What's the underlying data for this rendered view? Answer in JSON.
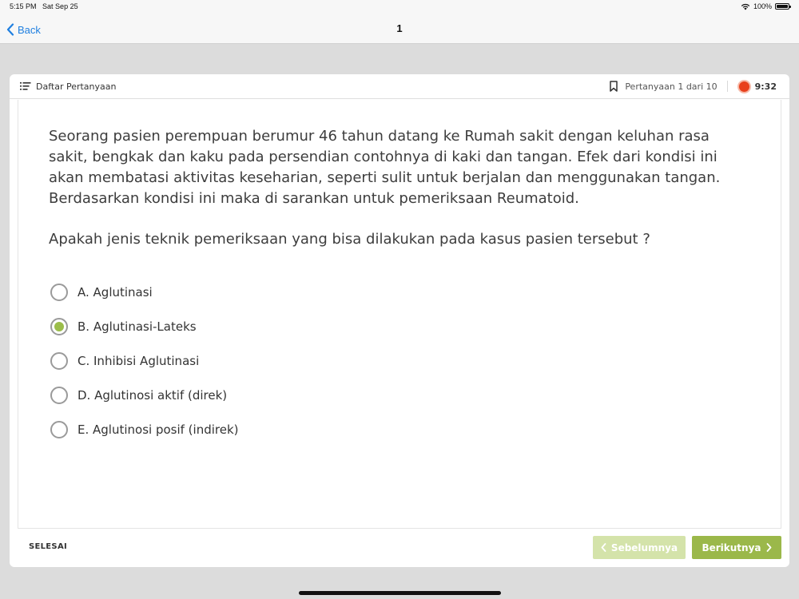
{
  "status_bar": {
    "time": "5:15 PM",
    "date": "Sat Sep 25",
    "battery": "100%"
  },
  "nav": {
    "back_label": "Back",
    "title": "1"
  },
  "header": {
    "list_label": "Daftar Pertanyaan",
    "question_counter": "Pertanyaan 1 dari 10",
    "timer": "9:32"
  },
  "question": {
    "text": "Seorang pasien perempuan berumur 46 tahun datang ke Rumah sakit dengan keluhan rasa sakit, bengkak dan kaku pada persendian contohnya di kaki dan tangan. Efek dari kondisi ini akan membatasi aktivitas keseharian, seperti sulit untuk berjalan dan menggunakan tangan. Berdasarkan kondisi ini maka di sarankan untuk pemeriksaan Reumatoid.",
    "prompt": "Apakah jenis teknik pemeriksaan yang bisa dilakukan pada kasus pasien tersebut ?",
    "options": [
      {
        "label": "A. Aglutinasi",
        "selected": false
      },
      {
        "label": "B. Aglutinasi-Lateks",
        "selected": true
      },
      {
        "label": "C. Inhibisi Aglutinasi",
        "selected": false
      },
      {
        "label": "D. Aglutinosi aktif (direk)",
        "selected": false
      },
      {
        "label": "E. Aglutinosi posif (indirek)",
        "selected": false
      }
    ]
  },
  "footer": {
    "finish_label": "SELESAI",
    "prev_label": "Sebelumnya",
    "next_label": "Berikutnya"
  },
  "colors": {
    "accent": "#9bb84a",
    "accent_disabled": "#d4e3aa",
    "link": "#1f7fe0",
    "timer": "#e8401c"
  },
  "icons": [
    "wifi-icon",
    "battery-icon",
    "chevron-left-icon",
    "list-icon",
    "bookmark-icon",
    "timer-icon",
    "chevron-right-icon"
  ]
}
